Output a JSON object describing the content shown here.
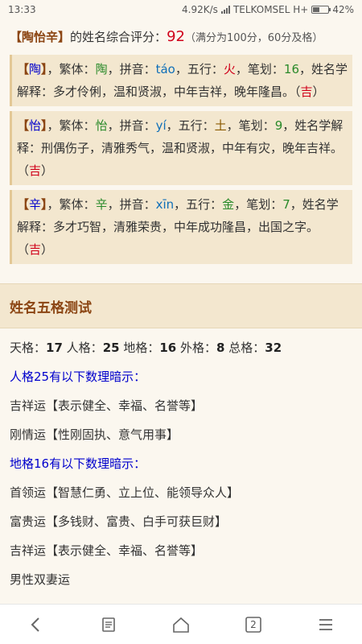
{
  "status_bar": {
    "time": "13:33",
    "speed": "4.92K/s",
    "carrier": "TELKOMSEL H+",
    "battery": "42%",
    "battery_level": 0.42
  },
  "summary": {
    "bracket_open": "【",
    "name": "陶怡辛",
    "bracket_close": "】",
    "text": "的姓名综合评分：",
    "score": "92",
    "note": "（满分为100分，60分及格）"
  },
  "chars": [
    {
      "char": "陶",
      "trad_label": "，繁体：",
      "trad": "陶",
      "pin_label": "，拼音：",
      "pinyin": "táo",
      "wx_label": "，五行：",
      "wuxing": "火",
      "strokes_label": "，笔划：",
      "strokes": "16",
      "desc": "，姓名学解释：多才伶俐，温和贤淑，中年吉祥，晚年隆昌。",
      "luck": "吉"
    },
    {
      "char": "怡",
      "trad_label": "，繁体：",
      "trad": "怡",
      "pin_label": "，拼音：",
      "pinyin": "yí",
      "wx_label": "，五行：",
      "wuxing": "土",
      "strokes_label": "，笔划：",
      "strokes": "9",
      "desc": "，姓名学解释：刑偶伤子，清雅秀气，温和贤淑，中年有灾，晚年吉祥。",
      "luck": "吉"
    },
    {
      "char": "辛",
      "trad_label": "，繁体：",
      "trad": "辛",
      "pin_label": "，拼音：",
      "pinyin": "xīn",
      "wx_label": "，五行：",
      "wuxing": "金",
      "strokes_label": "，笔划：",
      "strokes": "7",
      "desc": "，姓名学解释：多才巧智，清雅荣贵，中年成功隆昌，出国之字。",
      "luck": "吉"
    }
  ],
  "section": {
    "title": "姓名五格测试"
  },
  "wuge": {
    "tian_label": "天格：",
    "tian": "17",
    "ren_label": "人格：",
    "ren": "25",
    "di_label": "地格：",
    "di": "16",
    "wai_label": "外格：",
    "wai": "8",
    "zong_label": "总格：",
    "zong": "32",
    "ren_hint_title": "人格25有以下数理暗示：",
    "ren_hints": [
      "吉祥运【表示健全、幸福、名誉等】",
      "刚情运【性刚固执、意气用事】"
    ],
    "di_hint_title": "地格16有以下数理暗示：",
    "di_hints": [
      "首领运【智慧仁勇、立上位、能领导众人】",
      "富贵运【多钱财、富贵、白手可获巨财】",
      "吉祥运【表示健全、幸福、名誉等】",
      "男性双妻运"
    ]
  },
  "bottom_nav": {
    "tab_count": "2"
  }
}
